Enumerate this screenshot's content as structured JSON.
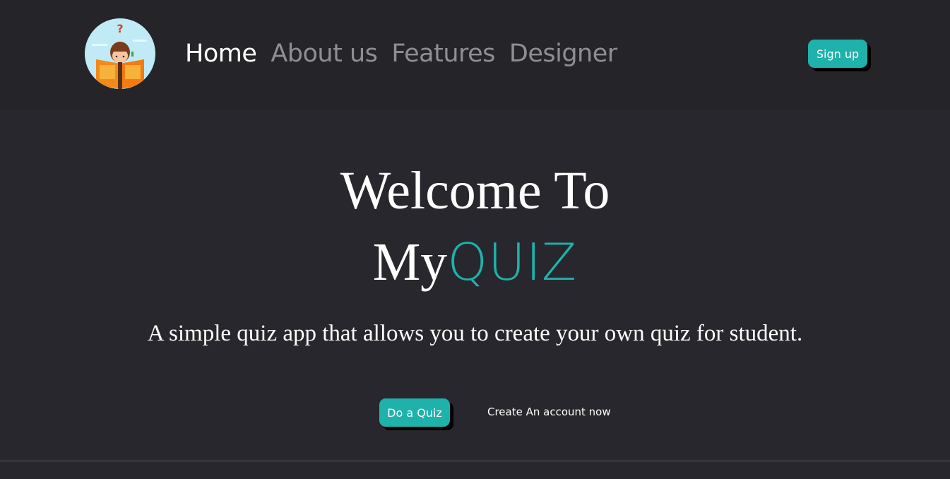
{
  "header": {
    "logo_icon": "reading-student-logo-icon",
    "nav": [
      {
        "label": "Home",
        "active": true
      },
      {
        "label": "About us",
        "active": false
      },
      {
        "label": "Features",
        "active": false
      },
      {
        "label": "Designer",
        "active": false
      }
    ],
    "signup_label": "Sign up"
  },
  "hero": {
    "title": "Welcome To",
    "brand_prefix": "My",
    "brand_highlight": "QUIZ",
    "subtitle": "A simple quiz app that allows you to create your own quiz for student.",
    "primary_button": "Do a Quiz",
    "secondary_link": "Create An account now"
  },
  "colors": {
    "background": "#27272d",
    "header_background": "#252529",
    "accent": "#1fb2aa",
    "nav_inactive": "#8f8f93",
    "text": "#ffffff"
  }
}
